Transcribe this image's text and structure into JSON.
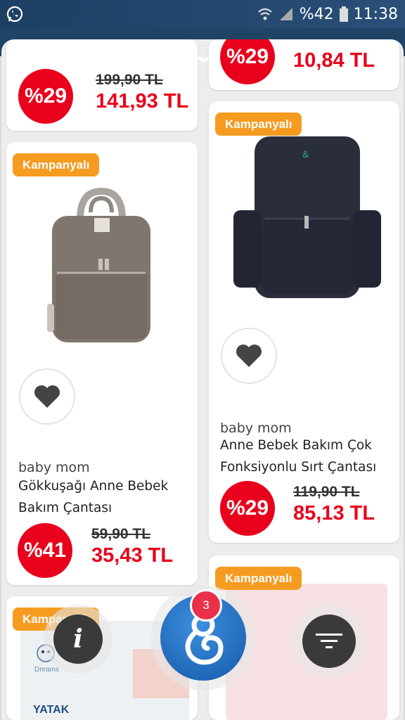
{
  "status_bar": {
    "battery": "%42",
    "time": "11:38"
  },
  "products": [
    {
      "old_price": "199,90 TL",
      "new_price": "141,93 TL",
      "discount": "%29"
    },
    {
      "discount": "%29",
      "new_price": "10,84 TL"
    },
    {
      "tag": "Kampanyalı",
      "brand": "baby mom",
      "title_line1": "Gökkuşağı Anne Bebek",
      "title_line2": "Bakım Çantası",
      "discount": "%41",
      "old_price": "59,90 TL",
      "new_price": "35,43 TL"
    },
    {
      "tag": "Kampanyalı",
      "brand": "baby mom",
      "title_line1": "Anne Bebek Bakım Çok",
      "title_line2": "Fonksiyonlu Sırt Çantası",
      "discount": "%29",
      "old_price": "119,90 TL",
      "new_price": "85,13 TL"
    },
    {
      "tag": "Kampanyalı",
      "image_text": "YATAK",
      "image_brand": "Dreams"
    },
    {
      "tag": "Kampanyalı"
    }
  ],
  "fabs": {
    "badge_count": "3",
    "info_label": "i"
  },
  "colors": {
    "accent_red": "#e8001c",
    "tag_orange": "#f59b1f",
    "fab_blue": "#1f6fc2"
  }
}
